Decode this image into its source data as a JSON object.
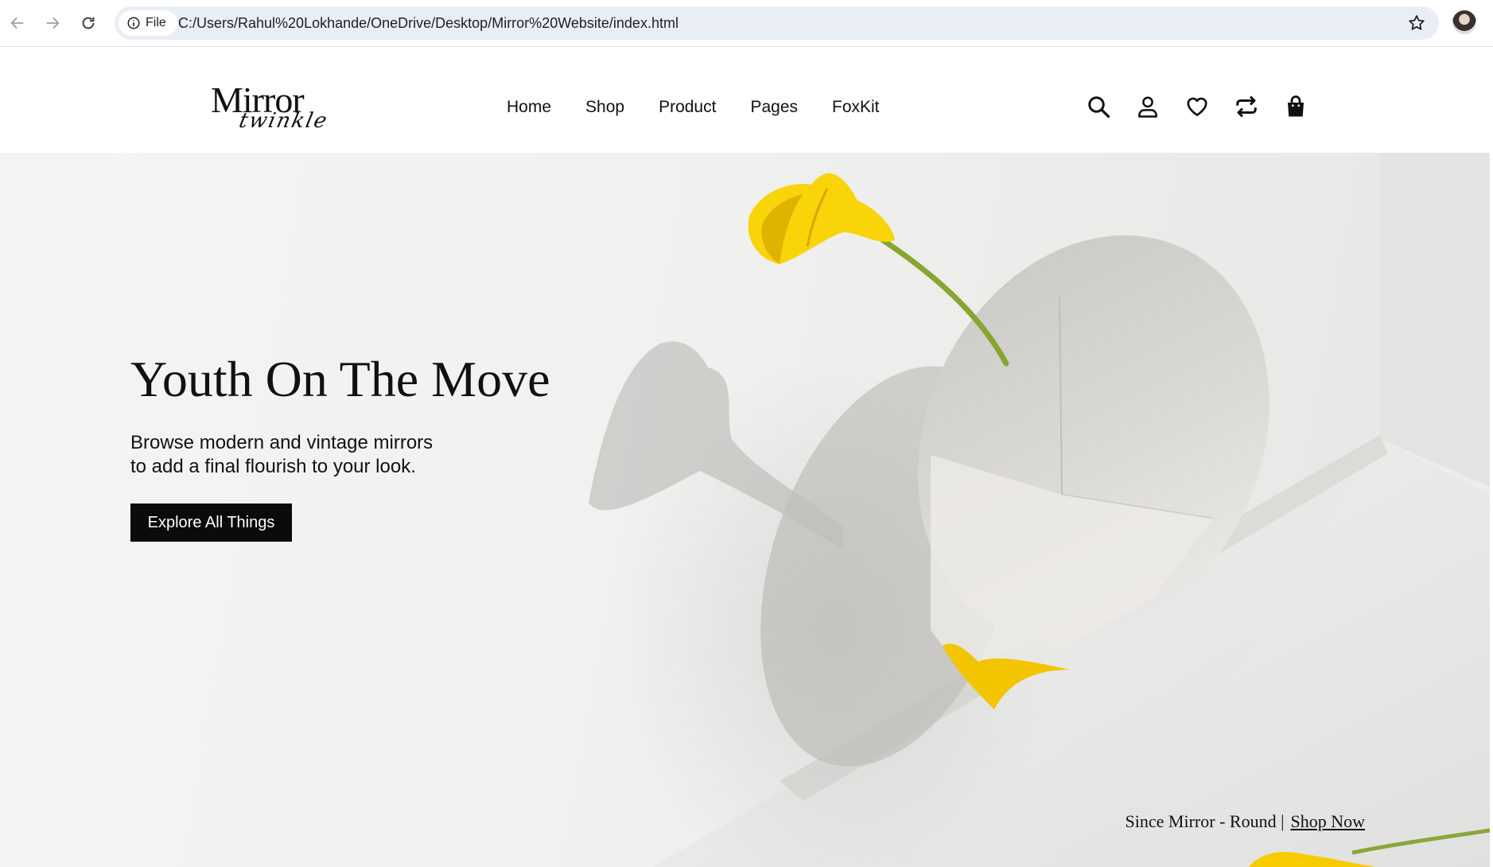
{
  "browser": {
    "chip_label": "File",
    "url": "C:/Users/Rahul%20Lokhande/OneDrive/Desktop/Mirror%20Website/index.html",
    "icons": [
      "back-icon",
      "forward-icon",
      "reload-icon",
      "info-icon",
      "star-icon",
      "profile-avatar"
    ]
  },
  "header": {
    "logo_main": "Mirror",
    "logo_sub": "twinkle",
    "menu": [
      "Home",
      "Shop",
      "Product",
      "Pages",
      "FoxKit"
    ],
    "icons": [
      "search-icon",
      "user-icon",
      "heart-icon",
      "compare-icon",
      "bag-icon"
    ]
  },
  "hero": {
    "title": "Youth On The Move",
    "desc_line1": "Browse modern and vintage mirrors",
    "desc_line2": "to add a final flourish to your look.",
    "button": "Explore All Things",
    "note_text": "Since Mirror - Round |",
    "note_link": "Shop Now"
  },
  "colors": {
    "accent_yellow": "#f6cc00",
    "button_bg": "#0b0b0b",
    "omnibox_bg": "#e9eef6"
  }
}
